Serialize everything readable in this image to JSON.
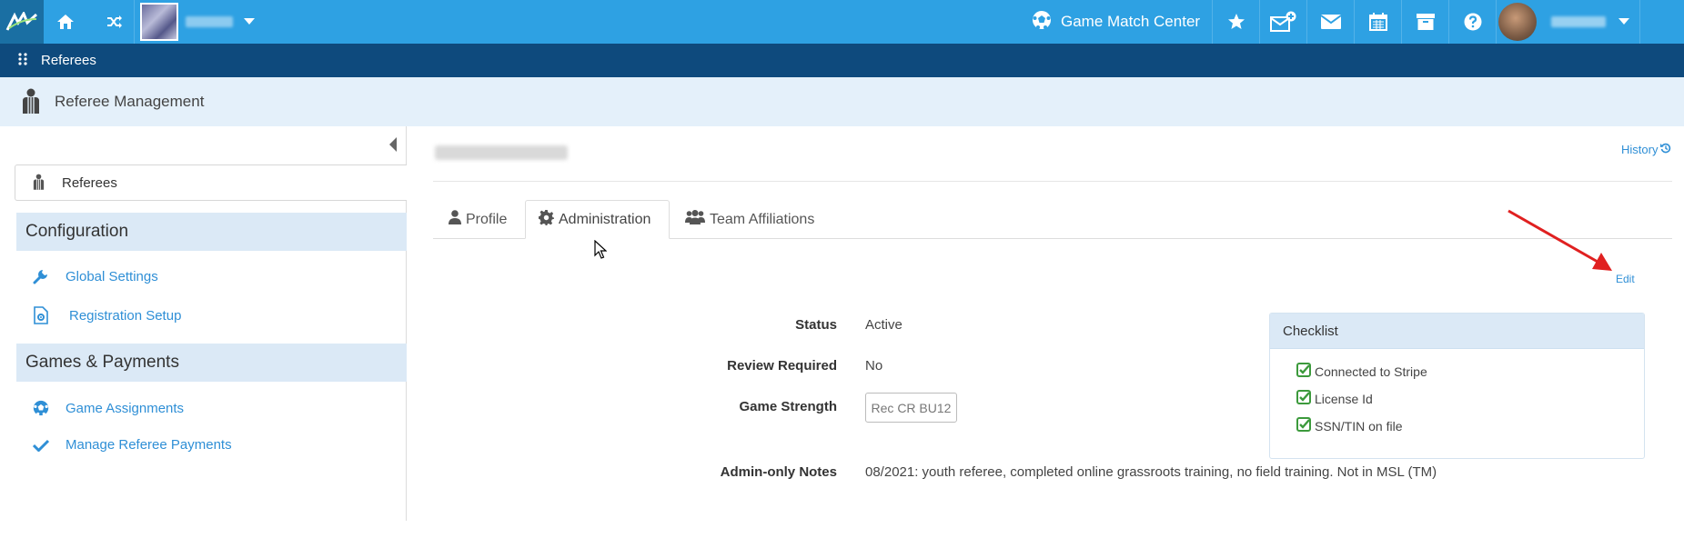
{
  "topbar": {
    "game_match_center": "Game Match Center"
  },
  "breadcrumb": {
    "current": "Referees"
  },
  "header": {
    "title": "Referee Management"
  },
  "sidebar": {
    "active_item": "Referees",
    "sections": [
      {
        "title": "Configuration",
        "items": [
          "Global Settings",
          "Registration Setup"
        ]
      },
      {
        "title": "Games & Payments",
        "items": [
          "Game Assignments",
          "Manage Referee Payments"
        ]
      }
    ]
  },
  "main": {
    "history_label": "History",
    "edit_label": "Edit",
    "tabs": [
      {
        "label": "Profile",
        "active": false
      },
      {
        "label": "Administration",
        "active": true
      },
      {
        "label": "Team Affiliations",
        "active": false
      }
    ],
    "fields": {
      "status_label": "Status",
      "status_value": "Active",
      "review_label": "Review Required",
      "review_value": "No",
      "strength_label": "Game Strength",
      "strength_value": "Rec CR BU12",
      "notes_label": "Admin-only Notes",
      "notes_value": "08/2021:  youth referee, completed online grassroots training, no field training. Not in MSL (TM)"
    },
    "checklist": {
      "title": "Checklist",
      "items": [
        "Connected to Stripe",
        "License Id",
        "SSN/TIN on file"
      ]
    }
  },
  "colors": {
    "topbar": "#2ea1e3",
    "breadcrumb_bar": "#0e4a7d",
    "header_band": "#e4f0fa",
    "link": "#2f8fd6",
    "check": "#3c9a3c",
    "arrow": "#e02020"
  },
  "icons": {
    "logo": "app-logo-icon",
    "home": "home-icon",
    "switch": "shuffle-icon",
    "game_match_center": "soccer-ball-icon",
    "favorites": "star-icon",
    "compose": "envelope-plus-icon",
    "messages": "envelope-icon",
    "calendar": "calendar-icon",
    "archive": "archive-icon",
    "help": "question-circle-icon"
  }
}
